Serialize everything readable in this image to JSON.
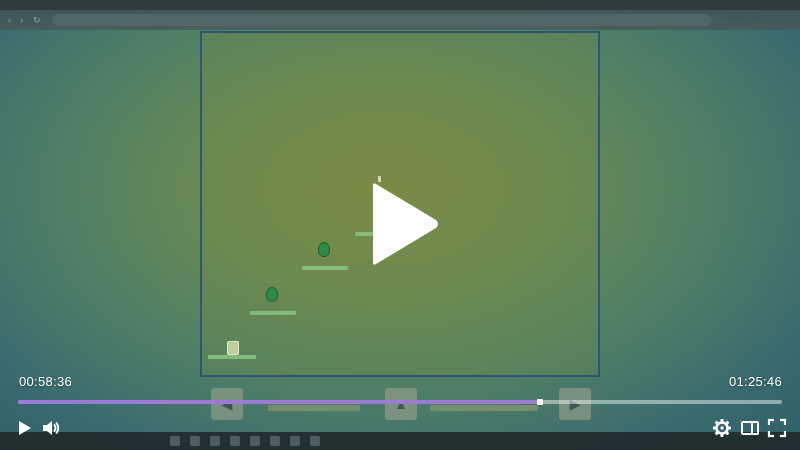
{
  "player": {
    "current_time": "00:58:36",
    "duration": "01:25:46",
    "progress_percent": 68.3,
    "accent_color": "#9b7bd6",
    "icons": {
      "big_play": "play-icon",
      "play": "play-icon",
      "volume": "volume-icon",
      "settings": "gear-icon",
      "theater": "theater-mode-icon",
      "fullscreen": "fullscreen-icon"
    }
  }
}
